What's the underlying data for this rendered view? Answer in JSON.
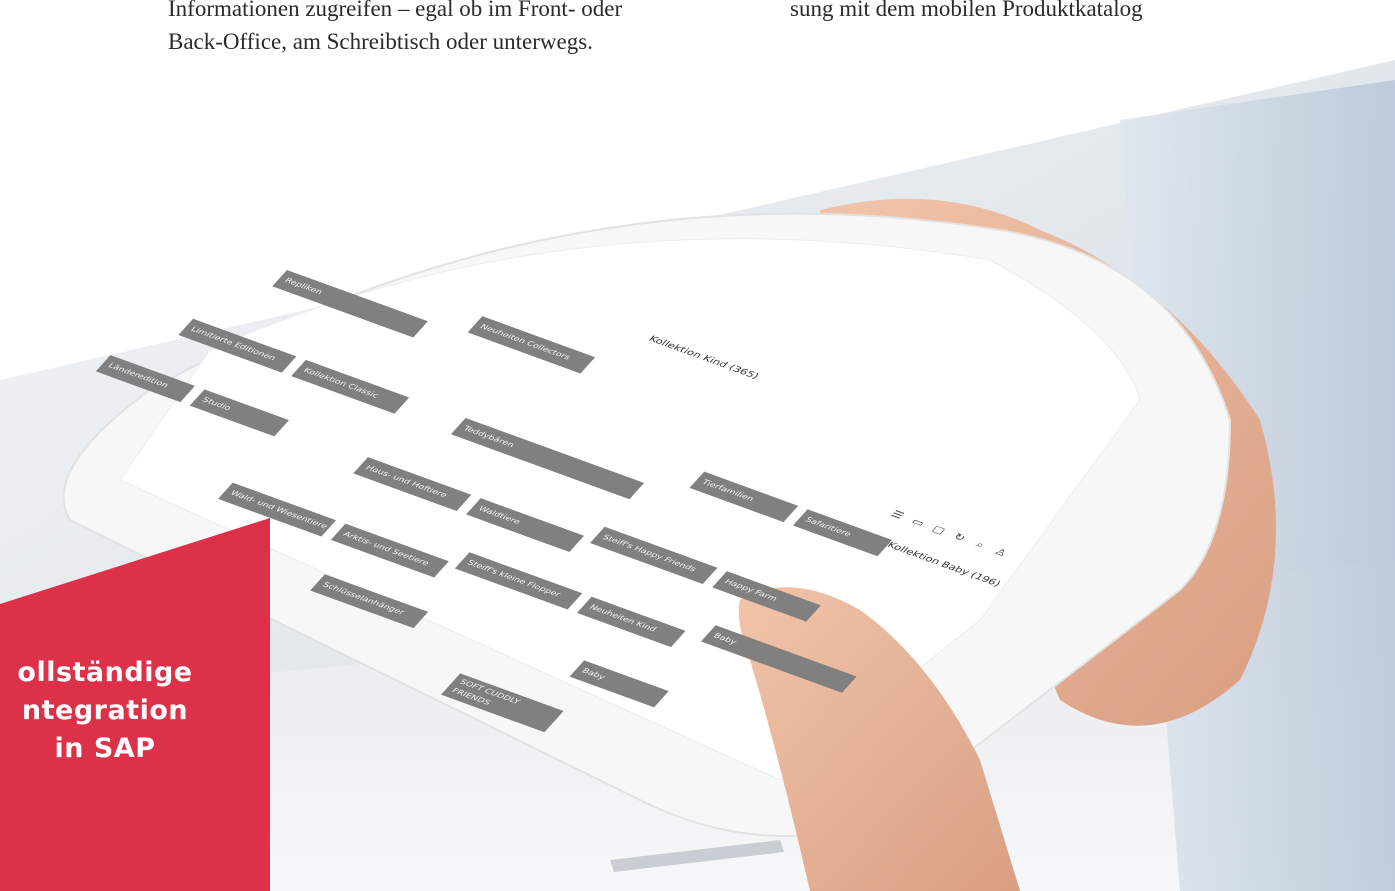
{
  "article": {
    "left_lines": [
      "Informationen zugreifen – egal ob im Front- oder",
      "Back-Office, am Schreibtisch oder unterwegs."
    ],
    "right_lines": [
      "sung mit dem mobilen Produktkatalog"
    ]
  },
  "tablet": {
    "collection_title": "Kollektion Kind (365)",
    "collection_baby": "Kollektion Baby (196)",
    "icons": [
      "menu-icon",
      "grid-icon",
      "chat-icon",
      "sync-icon",
      "search-icon",
      "user-icon"
    ],
    "tiles": [
      "Repliken",
      "Neuheiten Collectors",
      "Limitierte Editionen",
      "Kollektion Classic",
      "Teddybären",
      "Tierfamilien",
      "Safaritiere",
      "Länderedition",
      "Studio",
      "Haus- und Hoftiere",
      "Waldtiere",
      "Steiff's Happy Friends",
      "Happy Farm",
      "Wald- und Wiesentiere",
      "Arktis- und Seetiere",
      "Steiff's kleine Flopper",
      "Neuheiten Kind",
      "Baby",
      "Schlüsselanhänger",
      "Baby",
      "SOFT CUDDLY FRIENDS"
    ]
  },
  "promo": {
    "lines": [
      "ollständige",
      "ntegration",
      "in SAP"
    ],
    "color": "#dc3149"
  },
  "colors": {
    "tile": "#808080",
    "text": "#2a2a2a"
  }
}
